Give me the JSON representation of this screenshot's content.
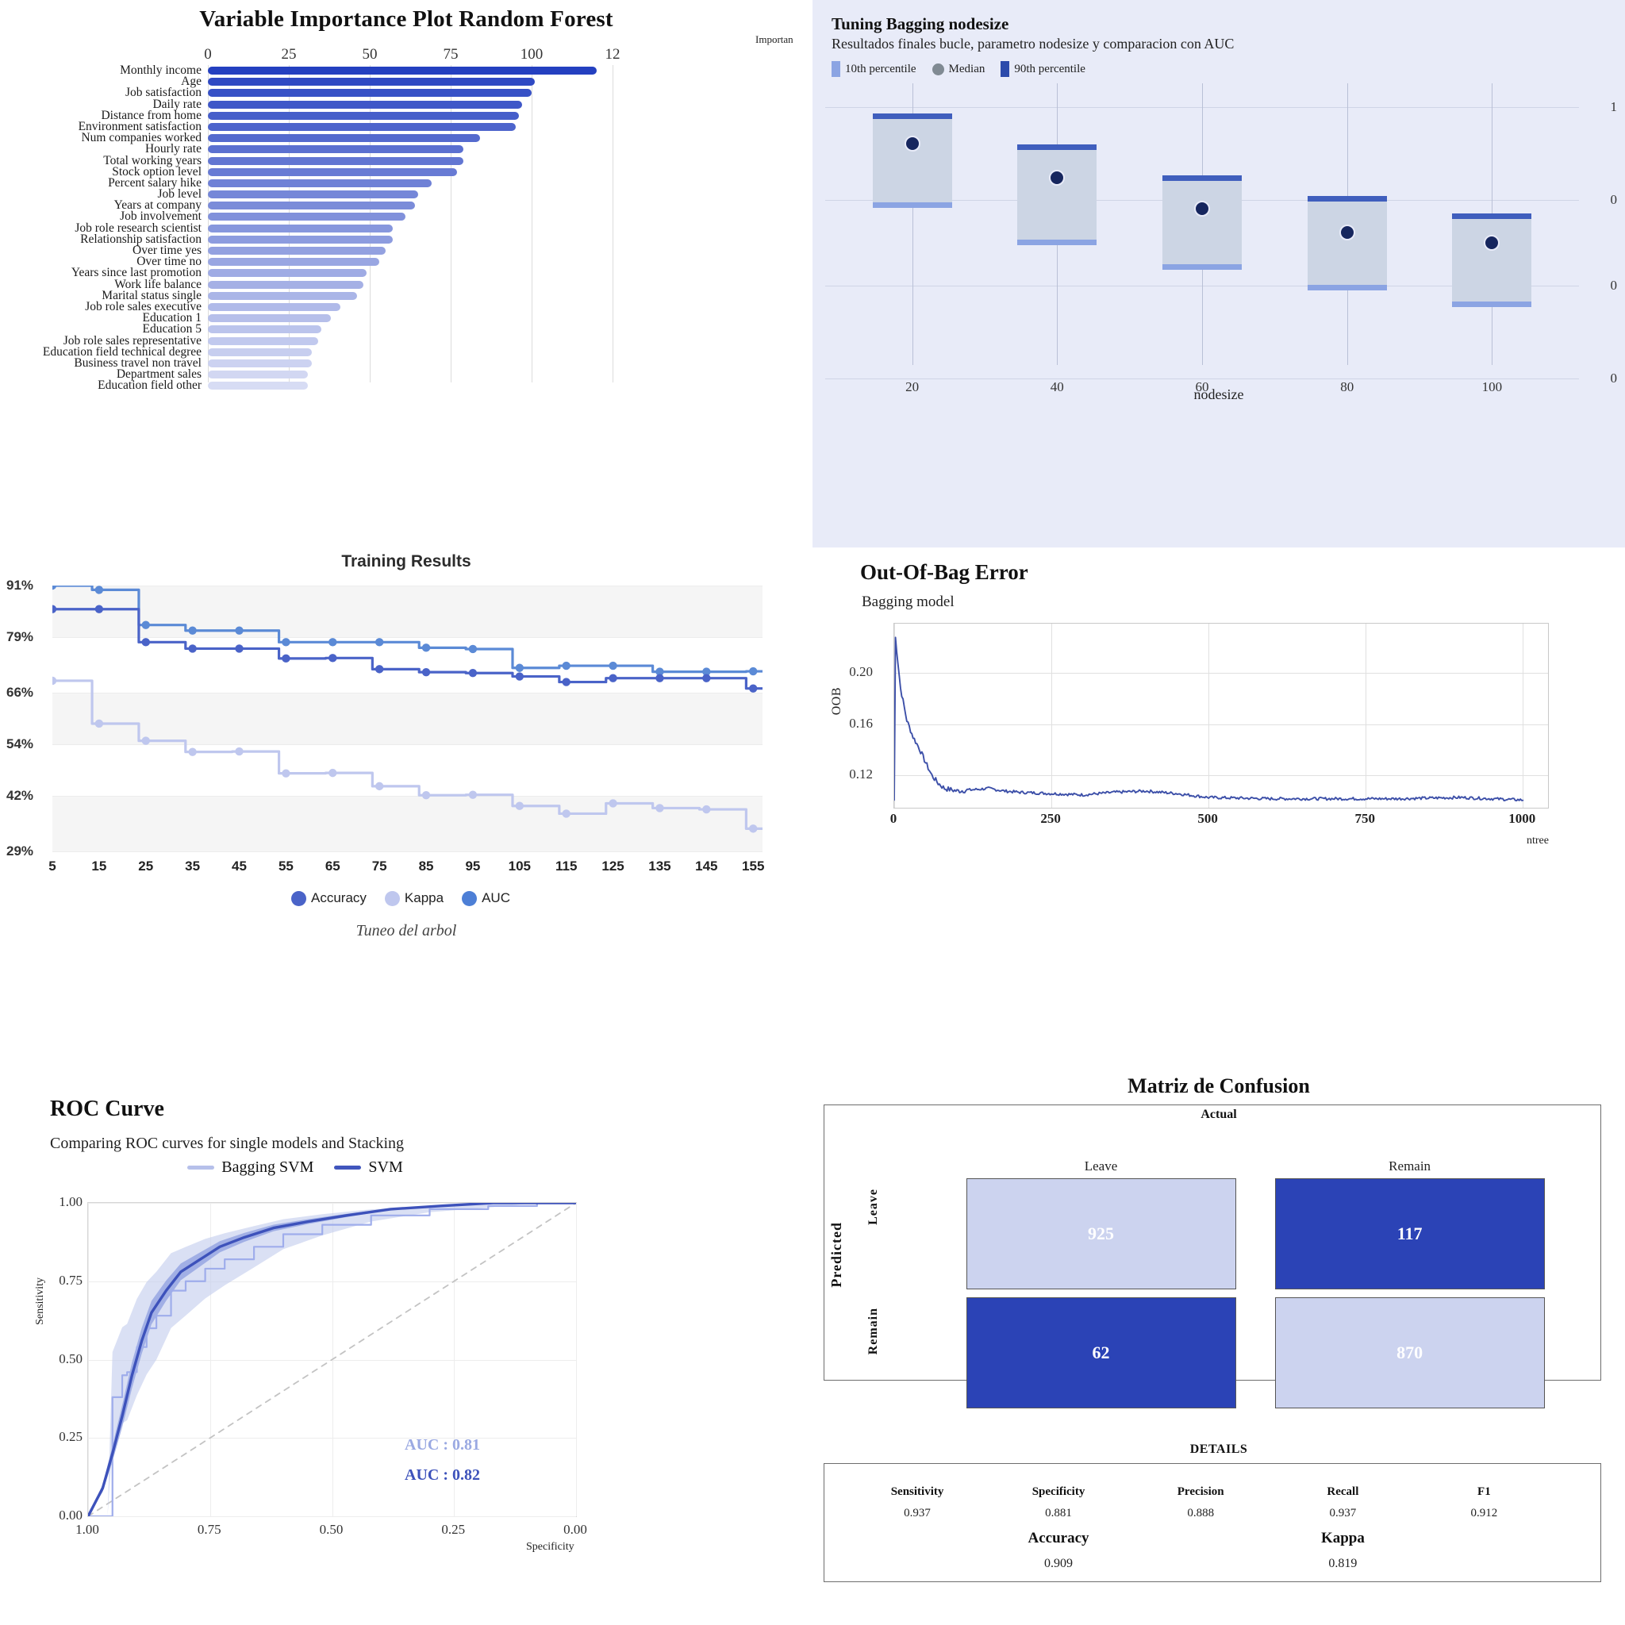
{
  "importance": {
    "title": "Variable Importance Plot Random Forest",
    "axis_title": "Importan",
    "xticks": [
      "0",
      "25",
      "50",
      "75",
      "100",
      "12"
    ],
    "chart_data": {
      "type": "bar",
      "title": "Variable Importance Plot Random Forest",
      "xlabel": "Importance",
      "ylabel": "",
      "orientation": "horizontal",
      "xlim": [
        0,
        125
      ],
      "grid": true,
      "categories": [
        "Monthly income",
        "Age",
        "Job satisfaction",
        "Daily rate",
        "Distance from home",
        "Environment satisfaction",
        "Num companies worked",
        "Hourly rate",
        "Total working years",
        "Stock option level",
        "Percent salary hike",
        "Job level",
        "Years at company",
        "Job involvement",
        "Job role research scientist",
        "Relationship satisfaction",
        "Over time yes",
        "Over time no",
        "Years since last promotion",
        "Work life balance",
        "Marital status single",
        "Job role sales executive",
        "Education 1",
        "Education 5",
        "Job role sales representative",
        "Education field technical degree",
        "Business travel non travel",
        "Department sales",
        "Education field other"
      ],
      "values": [
        120,
        101,
        100,
        97,
        96,
        95,
        84,
        79,
        79,
        77,
        69,
        65,
        64,
        61,
        57,
        57,
        55,
        53,
        49,
        48,
        46,
        41,
        38,
        35,
        34,
        32,
        32,
        31,
        31
      ]
    }
  },
  "tuning": {
    "title": "Tuning Bagging nodesize",
    "subtitle": "Resultados finales bucle, parametro nodesize y comparacion con AUC",
    "legend": [
      {
        "label": "10th percentile",
        "marker": "square",
        "color": "#8ba4e3"
      },
      {
        "label": "Median",
        "marker": "circle",
        "color": "#808a93"
      },
      {
        "label": "90th percentile",
        "marker": "square",
        "color": "#2b4aab"
      }
    ],
    "xlabel": "nodesize",
    "yticks": [
      "1",
      "0",
      "0",
      "0"
    ],
    "chart_data": {
      "type": "bar",
      "title": "Tuning Bagging nodesize",
      "subtitle": "Resultados finales bucle, parametro nodesize y comparacion con AUC",
      "xlabel": "nodesize",
      "ylabel": "",
      "categories": [
        20,
        40,
        60,
        80,
        100
      ],
      "series": [
        {
          "name": "10th percentile",
          "values": [
            0.565,
            0.455,
            0.385,
            0.325,
            0.275
          ]
        },
        {
          "name": "Median",
          "values": [
            0.745,
            0.645,
            0.555,
            0.485,
            0.455
          ]
        },
        {
          "name": "90th percentile",
          "values": [
            0.825,
            0.735,
            0.645,
            0.585,
            0.535
          ]
        }
      ],
      "xticks": [
        20,
        40,
        60,
        80,
        100
      ]
    }
  },
  "training": {
    "title": "Training Results",
    "caption": "Tuneo del arbol",
    "yticks": [
      "91%",
      "79%",
      "66%",
      "54%",
      "42%",
      "29%"
    ],
    "xticks": [
      "5",
      "15",
      "25",
      "35",
      "45",
      "55",
      "65",
      "75",
      "85",
      "95",
      "105",
      "115",
      "125",
      "135",
      "145",
      "155"
    ],
    "legend": [
      {
        "label": "Accuracy",
        "color": "#4a63c8"
      },
      {
        "label": "Kappa",
        "color": "#bfc7ee"
      },
      {
        "label": "AUC",
        "color": "#4d7fd6"
      }
    ],
    "chart_data": {
      "type": "line",
      "title": "Training Results",
      "xlabel": "Tuneo del arbol",
      "ylabel": "",
      "ylim": [
        29,
        91
      ],
      "grid": true,
      "x": [
        5,
        15,
        25,
        35,
        45,
        55,
        65,
        75,
        85,
        95,
        105,
        115,
        125,
        135,
        145,
        155
      ],
      "series": [
        {
          "name": "AUC",
          "values": [
            91.0,
            90.0,
            81.8,
            80.5,
            80.5,
            77.8,
            77.8,
            77.8,
            76.5,
            76.2,
            71.8,
            72.3,
            72.3,
            70.9,
            70.9,
            71.0
          ]
        },
        {
          "name": "Accuracy",
          "values": [
            85.5,
            85.5,
            77.8,
            76.3,
            76.3,
            74.0,
            74.1,
            71.5,
            70.8,
            70.6,
            69.8,
            68.5,
            69.4,
            69.4,
            69.4,
            67.0
          ]
        },
        {
          "name": "Kappa",
          "values": [
            68.8,
            58.8,
            54.8,
            52.2,
            52.3,
            47.2,
            47.3,
            44.2,
            42.1,
            42.2,
            39.6,
            37.8,
            40.2,
            39.1,
            38.8,
            34.3
          ]
        }
      ]
    }
  },
  "oob": {
    "title": "Out-Of-Bag Error",
    "subtitle": "Bagging model",
    "ylabel": "OOB",
    "xlabel": "ntree",
    "yticks": [
      "0.20",
      "0.16",
      "0.12"
    ],
    "xticks": [
      "0",
      "250",
      "500",
      "750",
      "1000"
    ],
    "chart_data": {
      "type": "line",
      "title": "Out-Of-Bag Error",
      "subtitle": "Bagging model",
      "xlabel": "ntree",
      "ylabel": "OOB",
      "xlim": [
        0,
        1000
      ],
      "ylim": [
        0.095,
        0.235
      ],
      "grid": true,
      "series": [
        {
          "name": "OOB error",
          "x": [
            1,
            10,
            20,
            30,
            40,
            50,
            60,
            70,
            80,
            100,
            125,
            150,
            175,
            200,
            250,
            300,
            350,
            400,
            450,
            500,
            600,
            700,
            800,
            900,
            1000
          ],
          "values": [
            0.232,
            0.188,
            0.163,
            0.15,
            0.141,
            0.13,
            0.12,
            0.114,
            0.11,
            0.108,
            0.109,
            0.11,
            0.108,
            0.107,
            0.106,
            0.105,
            0.107,
            0.108,
            0.106,
            0.103,
            0.102,
            0.102,
            0.102,
            0.103,
            0.101
          ]
        }
      ]
    }
  },
  "roc": {
    "title": "ROC Curve",
    "subtitle": "Comparing ROC curves for single models and Stacking",
    "xlabel": "Specificity",
    "ylabel": "Sensitivity",
    "yticks": [
      "1.00",
      "0.75",
      "0.50",
      "0.25",
      "0.00"
    ],
    "xticks": [
      "1.00",
      "0.75",
      "0.50",
      "0.25",
      "0.00"
    ],
    "legend": [
      {
        "label": "Bagging SVM",
        "color": "#b6c0ea"
      },
      {
        "label": "SVM",
        "color": "#4156bd"
      }
    ],
    "auc_labels": [
      {
        "label": "AUC : 0.81",
        "color": "#9aa9e2"
      },
      {
        "label": "AUC : 0.82",
        "color": "#3d52bb"
      }
    ],
    "chart_data": {
      "type": "line",
      "title": "ROC Curve",
      "subtitle": "Comparing ROC curves for single models and Stacking",
      "xlabel": "Specificity",
      "ylabel": "Sensitivity",
      "xlim": [
        1.0,
        0.0
      ],
      "ylim": [
        0.0,
        1.0
      ],
      "x_reversed": true,
      "grid": true,
      "annotations": [
        "AUC : 0.81",
        "AUC : 0.82"
      ],
      "series": [
        {
          "name": "Bagging SVM",
          "auc": 0.81,
          "specificity": [
            1.0,
            0.96,
            0.95,
            0.93,
            0.92,
            0.9,
            0.88,
            0.86,
            0.83,
            0.8,
            0.76,
            0.72,
            0.66,
            0.6,
            0.52,
            0.42,
            0.3,
            0.18,
            0.08,
            0.0
          ],
          "sensitivity": [
            0.0,
            0.0,
            0.38,
            0.45,
            0.46,
            0.54,
            0.6,
            0.64,
            0.72,
            0.75,
            0.79,
            0.82,
            0.86,
            0.9,
            0.93,
            0.96,
            0.98,
            0.99,
            1.0,
            1.0
          ]
        },
        {
          "name": "SVM",
          "auc": 0.82,
          "specificity": [
            1.0,
            0.97,
            0.95,
            0.93,
            0.91,
            0.89,
            0.87,
            0.84,
            0.81,
            0.77,
            0.73,
            0.68,
            0.62,
            0.55,
            0.47,
            0.38,
            0.28,
            0.17,
            0.08,
            0.0
          ],
          "sensitivity": [
            0.0,
            0.09,
            0.2,
            0.32,
            0.45,
            0.56,
            0.65,
            0.72,
            0.78,
            0.82,
            0.86,
            0.89,
            0.92,
            0.94,
            0.96,
            0.98,
            0.99,
            1.0,
            1.0,
            1.0
          ]
        }
      ]
    }
  },
  "confusion": {
    "title": "Matriz de Confusion",
    "actual_label": "Actual",
    "predicted_label": "Predicted",
    "col_headers": [
      "Leave",
      "Remain"
    ],
    "row_headers": [
      "Leave",
      "Remain"
    ],
    "chart_data": {
      "type": "heatmap",
      "title": "Matriz de Confusion",
      "xlabel": "Actual",
      "ylabel": "Predicted",
      "x_categories": [
        "Leave",
        "Remain"
      ],
      "y_categories": [
        "Leave",
        "Remain"
      ],
      "values": [
        [
          925,
          117
        ],
        [
          62,
          870
        ]
      ]
    },
    "cells": [
      {
        "value": "925",
        "fill": "#ccd3ef",
        "text": "#ffffff"
      },
      {
        "value": "117",
        "fill": "#2b43b6",
        "text": "#ffffff"
      },
      {
        "value": "62",
        "fill": "#2b43b6",
        "text": "#ffffff"
      },
      {
        "value": "870",
        "fill": "#ccd3ef",
        "text": "#ffffff"
      }
    ]
  },
  "details": {
    "header": "DETAILS",
    "row1": [
      {
        "name": "Sensitivity",
        "value": "0.937"
      },
      {
        "name": "Specificity",
        "value": "0.881"
      },
      {
        "name": "Precision",
        "value": "0.888"
      },
      {
        "name": "Recall",
        "value": "0.937"
      },
      {
        "name": "F1",
        "value": "0.912"
      }
    ],
    "row2": [
      {
        "name": "Accuracy",
        "value": "0.909"
      },
      {
        "name": "Kappa",
        "value": "0.819"
      }
    ]
  },
  "colors": {
    "bar_dark": "#2440c0",
    "bar_light": "#d7dcf4",
    "panel_bg": "#e8ebf8",
    "accent": "#4156bd"
  }
}
